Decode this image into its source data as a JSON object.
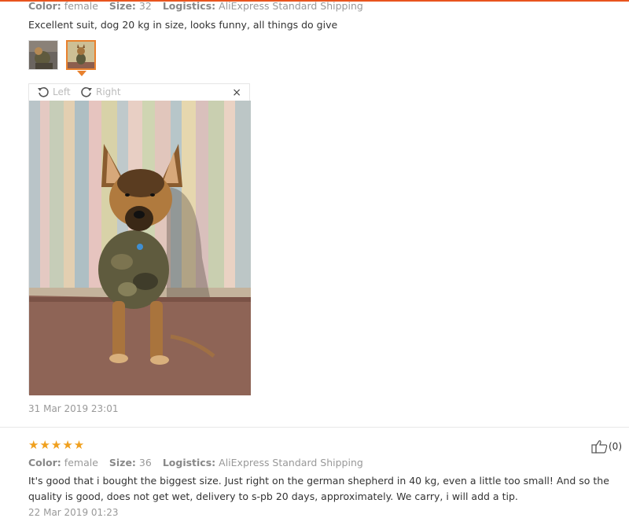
{
  "review1": {
    "color_label": "Color:",
    "color_value": "female",
    "size_label": "Size:",
    "size_value": "32",
    "logistics_label": "Logistics:",
    "logistics_value": "AliExpress Standard Shipping",
    "text": "Excellent suit, dog 20 kg in size, looks funny, all things do give",
    "thumbnails": [
      "dog-photo-thumbnail",
      "dog-photo-thumbnail-selected"
    ],
    "viewer": {
      "rotate_left_label": "Left",
      "rotate_right_label": "Right",
      "close_label": "×"
    },
    "date": "31 Mar 2019 23:01"
  },
  "review2": {
    "stars": "★★★★★",
    "rating": 5,
    "color_label": "Color:",
    "color_value": "female",
    "size_label": "Size:",
    "size_value": "36",
    "logistics_label": "Logistics:",
    "logistics_value": "AliExpress Standard Shipping",
    "helpful_count": "(0)",
    "text": "It's good that i bought the biggest size. Just right on the german shepherd in 40 kg, even a little too small! And so the quality is good, does not get wet, delivery to s-pb 20 days, approximately. We carry, i will add a tip.",
    "date": "22 Mar 2019 01:23"
  },
  "colors": {
    "accent": "#e8541e",
    "star": "#f0a01e",
    "meta_text": "#999999"
  }
}
